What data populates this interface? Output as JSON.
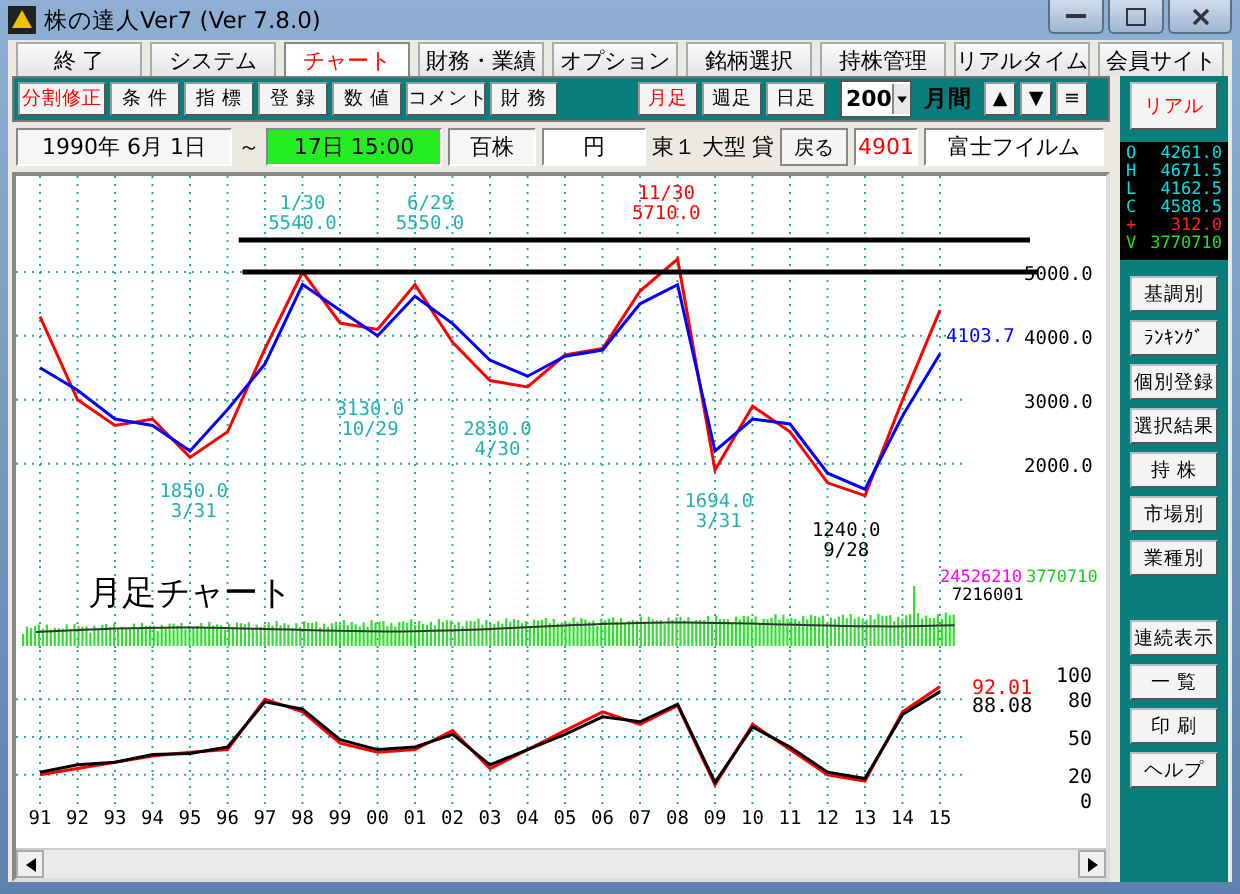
{
  "window": {
    "title": "株の達人Ver7 (Ver 7.8.0)"
  },
  "menu": [
    {
      "label": "終 了",
      "selected": false
    },
    {
      "label": "システム",
      "selected": false
    },
    {
      "label": "チャート",
      "selected": true
    },
    {
      "label": "財務・業績",
      "selected": false
    },
    {
      "label": "オプション",
      "selected": false
    },
    {
      "label": "銘柄選択",
      "selected": false
    },
    {
      "label": "持株管理",
      "selected": false
    },
    {
      "label": "リアルタイム",
      "selected": false
    },
    {
      "label": "会員サイト",
      "selected": false
    }
  ],
  "toolbar": {
    "buttons": [
      {
        "label": "分割修正",
        "alert": true
      },
      {
        "label": "条 件",
        "alert": false
      },
      {
        "label": "指 標",
        "alert": false
      },
      {
        "label": "登 録",
        "alert": false
      },
      {
        "label": "数 値",
        "alert": false
      },
      {
        "label": "コメント",
        "alert": false
      },
      {
        "label": "財 務",
        "alert": false
      }
    ],
    "period_buttons": [
      {
        "label": "月足",
        "selected": true
      },
      {
        "label": "週足",
        "selected": false
      },
      {
        "label": "日足",
        "selected": false
      }
    ],
    "count": "200",
    "unit": "月間",
    "nav": [
      "▲",
      "▼",
      "≡"
    ]
  },
  "info": {
    "start_date": "1990年 6月 1日",
    "tilde": "～",
    "time": "17日 15:00",
    "lot": "百株",
    "currency": "円",
    "market": "東１",
    "size": "大型",
    "margin": "貸",
    "back_button": "戻る",
    "code": "4901",
    "name": "富士フイルム"
  },
  "chart": {
    "price": {
      "reading": "4103.7",
      "chart_data": {
        "type": "line",
        "grid": true,
        "ylim": [
          400,
          6500
        ],
        "yticks": [
          {
            "value": 5000,
            "label": "5000.0"
          },
          {
            "value": 4000,
            "label": "4000.0"
          },
          {
            "value": 3000,
            "label": "3000.0"
          },
          {
            "value": 2000,
            "label": "2000.0"
          }
        ],
        "series": [
          {
            "color": "#ff0000",
            "values": [
              4300,
              3000,
              2600,
              2700,
              2100,
              2500,
              3800,
              5000,
              4200,
              4100,
              4800,
              3900,
              3300,
              3200,
              3700,
              3800,
              4700,
              5200,
              1900,
              2900,
              2500,
              1700,
              1500,
              3000,
              4400
            ]
          },
          {
            "color": "#0000ff",
            "values": [
              3500,
              3150,
              2700,
              2600,
              2200,
              2850,
              3560,
              4800,
              4400,
              4000,
              4620,
              4190,
              3620,
              3370,
              3680,
              3780,
              4500,
              4800,
              2200,
              2700,
              2620,
              1850,
              1600,
              2750,
              3720
            ]
          }
        ],
        "ref_lines": [
          {
            "axis": "y",
            "value": 5500
          },
          {
            "axis": "y",
            "value": 5000
          }
        ],
        "annotations": [
          "1/30",
          "5540.0",
          "6/29",
          "5550.0",
          "11/30",
          "5710.0",
          "1850.0",
          "3/31",
          "3130.0",
          "10/29",
          "2830.0",
          "4/30",
          "1694.0",
          "3/31",
          "1240.0",
          "9/28"
        ]
      }
    },
    "title": "月足チャート",
    "volume_readings": [
      {
        "text": "24526210",
        "color": "#ff00ff"
      },
      {
        "text": "3770710",
        "color": "#22cc22"
      },
      {
        "text": "7216001",
        "color": "#000000"
      }
    ],
    "oscillator": {
      "readings": [
        {
          "text": "92.01",
          "color": "#ff0000"
        },
        {
          "text": "88.08",
          "color": "#000000"
        }
      ],
      "chart_data": {
        "type": "line",
        "grid": true,
        "categories": [
          "91",
          "92",
          "93",
          "94",
          "95",
          "96",
          "97",
          "98",
          "99",
          "00",
          "01",
          "02",
          "03",
          "04",
          "05",
          "06",
          "07",
          "08",
          "09",
          "10",
          "11",
          "12",
          "13",
          "14",
          "15"
        ],
        "ylim": [
          0,
          100
        ],
        "yticks": [
          {
            "value": 100,
            "label": "100"
          },
          {
            "value": 80,
            "label": "80"
          },
          {
            "value": 50,
            "label": "50"
          },
          {
            "value": 20,
            "label": "20"
          },
          {
            "value": 0,
            "label": "0"
          }
        ],
        "series": [
          {
            "color": "#ff0000",
            "values": [
              20,
              25,
              30,
              35,
              38,
              40,
              80,
              70,
              45,
              38,
              40,
              55,
              25,
              40,
              55,
              70,
              60,
              75,
              12,
              60,
              40,
              20,
              15,
              70,
              90
            ]
          },
          {
            "color": "#000000",
            "values": [
              22,
              28,
              30,
              36,
              37,
              42,
              78,
              72,
              48,
              40,
              42,
              52,
              28,
              40,
              52,
              66,
              62,
              76,
              14,
              58,
              42,
              22,
              17,
              68,
              86
            ]
          }
        ]
      }
    }
  },
  "sidebar": {
    "real_button": "リアル",
    "quote": [
      {
        "key": "O",
        "value": "4261.0",
        "color": "#00e0e0"
      },
      {
        "key": "H",
        "value": "4671.5",
        "color": "#00e0e0"
      },
      {
        "key": "L",
        "value": "4162.5",
        "color": "#00e0e0"
      },
      {
        "key": "C",
        "value": "4588.5",
        "color": "#00e0e0"
      },
      {
        "key": "+",
        "value": "312.0",
        "color": "#ff2020"
      },
      {
        "key": "V",
        "value": "3770710",
        "color": "#20e020"
      }
    ],
    "buttons": [
      "基調別",
      "ﾗﾝｷﾝｸﾞ",
      "個別登録",
      "選択結果",
      "持 株",
      "市場別",
      "業種別"
    ],
    "buttons_2": [
      "連続表示",
      "一 覧",
      "印 刷",
      "ヘルプ"
    ]
  }
}
